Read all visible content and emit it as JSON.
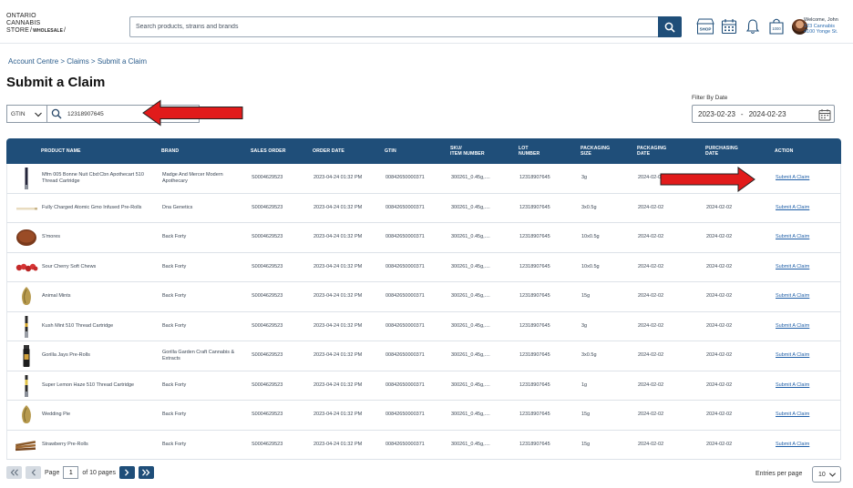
{
  "logo": {
    "line1": "ONTARIO",
    "line2": "CANNABIS",
    "line3": "STORE",
    "sub": "WHOLESALE"
  },
  "search": {
    "placeholder": "Search products, strains and brands"
  },
  "header_icons": [
    "shop-icon",
    "calendar-icon",
    "bell-icon",
    "cart-icon"
  ],
  "shop_label": "SHOP",
  "cart_count": "1000",
  "user": {
    "welcome": "Welcome, John",
    "address1": "123 Cannabis",
    "address2": "4100 Yonge St."
  },
  "breadcrumb": "Account Centre > Claims > Submit a Claim",
  "page_title": "Submit a Claim",
  "filter": {
    "type": "GTIN",
    "value": "12318907645"
  },
  "date_filter": {
    "label": "Filter By Date",
    "from": "2023-02-23",
    "separator": "-",
    "to": "2024-02-23"
  },
  "table": {
    "columns": [
      "PRODUCT NAME",
      "BRAND",
      "SALES ORDER",
      "ORDER DATE",
      "GTIN",
      "SKU/\nITEM NUMBER",
      "LOT\nNUMBER",
      "PACKAGING\nSIZE",
      "PACKAGING\nDATE",
      "PURCHASING\nDATE",
      "ACTION"
    ],
    "rows": [
      {
        "product": "Mfm 005 Bonne Nuit Cbd:Cbn Apothecart 510 Thread Cartridge",
        "brand": "Madge And Mercer Modern Apothecary",
        "so": "S0004629523",
        "od": "2023-04-24 01:32 PM",
        "gtin": "00842650000371",
        "sku": "300261_0.45g,....",
        "lot": "12318907645",
        "size": "3g",
        "pkg": "2024-02-0",
        "pur": "",
        "action": "Submit A Claim",
        "thumb": "cartridge"
      },
      {
        "product": "Fully Charged Atomic Gmo Infused Pre-Rolls",
        "brand": "Dna Genetics",
        "so": "S0004629523",
        "od": "2023-04-24 01:32 PM",
        "gtin": "00842650000371",
        "sku": "300261_0.45g,....",
        "lot": "12318907645",
        "size": "3x0.5g",
        "pkg": "2024-02-02",
        "pur": "2024-02-02",
        "action": "Submit A Claim",
        "thumb": "preroll"
      },
      {
        "product": "S'mores",
        "brand": "Back Forty",
        "so": "S0004629523",
        "od": "2023-04-24 01:32 PM",
        "gtin": "00842650000371",
        "sku": "300261_0.45g,....",
        "lot": "12318907645",
        "size": "10x0.5g",
        "pkg": "2024-02-02",
        "pur": "2024-02-02",
        "action": "Submit A Claim",
        "thumb": "disc"
      },
      {
        "product": "Sour Cherry Soft Chews",
        "brand": "Back Forty",
        "so": "S0004629523",
        "od": "2023-04-24 01:32 PM",
        "gtin": "00842650000371",
        "sku": "300261_0.45g,....",
        "lot": "12318907645",
        "size": "10x0.5g",
        "pkg": "2024-02-02",
        "pur": "2024-02-02",
        "action": "Submit A Claim",
        "thumb": "chews"
      },
      {
        "product": "Animal Mints",
        "brand": "Back Forty",
        "so": "S0004629523",
        "od": "2023-04-24 01:32 PM",
        "gtin": "00842650000371",
        "sku": "300261_0.45g,....",
        "lot": "12318907645",
        "size": "15g",
        "pkg": "2024-02-02",
        "pur": "2024-02-02",
        "action": "Submit A Claim",
        "thumb": "bud"
      },
      {
        "product": "Kush Mint 510 Thread Cartridge",
        "brand": "Back Forty",
        "so": "S0004629523",
        "od": "2023-04-24 01:32 PM",
        "gtin": "00842650000371",
        "sku": "300261_0.45g,....",
        "lot": "12318907645",
        "size": "3g",
        "pkg": "2024-02-02",
        "pur": "2024-02-02",
        "action": "Submit A Claim",
        "thumb": "cartridge2"
      },
      {
        "product": "Gorilla Jays Pre-Rolls",
        "brand": "Gorilla Garden Craft Cannabis & Extracts",
        "so": "S0004629523",
        "od": "2023-04-24 01:32 PM",
        "gtin": "00842650000371",
        "sku": "300261_0.45g,....",
        "lot": "12318907645",
        "size": "3x0.5g",
        "pkg": "2024-02-02",
        "pur": "2024-02-02",
        "action": "Submit A Claim",
        "thumb": "tube"
      },
      {
        "product": "Super Lemon Haze 510 Thread Cartridge",
        "brand": "Back Forty",
        "so": "S0004629523",
        "od": "2023-04-24 01:32 PM",
        "gtin": "00842650000371",
        "sku": "300261_0.45g,....",
        "lot": "12318907645",
        "size": "1g",
        "pkg": "2024-02-02",
        "pur": "2024-02-02",
        "action": "Submit A Claim",
        "thumb": "cartridge3"
      },
      {
        "product": "Wedding Pie",
        "brand": "Back Forty",
        "so": "S0004629523",
        "od": "2023-04-24 01:32 PM",
        "gtin": "00842650000371",
        "sku": "300261_0.45g,....",
        "lot": "12318907645",
        "size": "15g",
        "pkg": "2024-02-02",
        "pur": "2024-02-02",
        "action": "Submit A Claim",
        "thumb": "bud"
      },
      {
        "product": "Strawberry Pre-Rolls",
        "brand": "Back Forty",
        "so": "S0004629523",
        "od": "2023-04-24 01:32 PM",
        "gtin": "00842650000371",
        "sku": "300261_0.45g,....",
        "lot": "12318907645",
        "size": "15g",
        "pkg": "2024-02-02",
        "pur": "2024-02-02",
        "action": "Submit A Claim",
        "thumb": "prerolls"
      }
    ]
  },
  "pagination": {
    "page_label": "Page",
    "current": "1",
    "of_label": "of 10 pages"
  },
  "entries": {
    "label": "Entries per page",
    "value": "10"
  },
  "colors": {
    "header_blue": "#1f4e79",
    "link_blue": "#1f5fa8",
    "annotation_red": "#e11b1b"
  }
}
